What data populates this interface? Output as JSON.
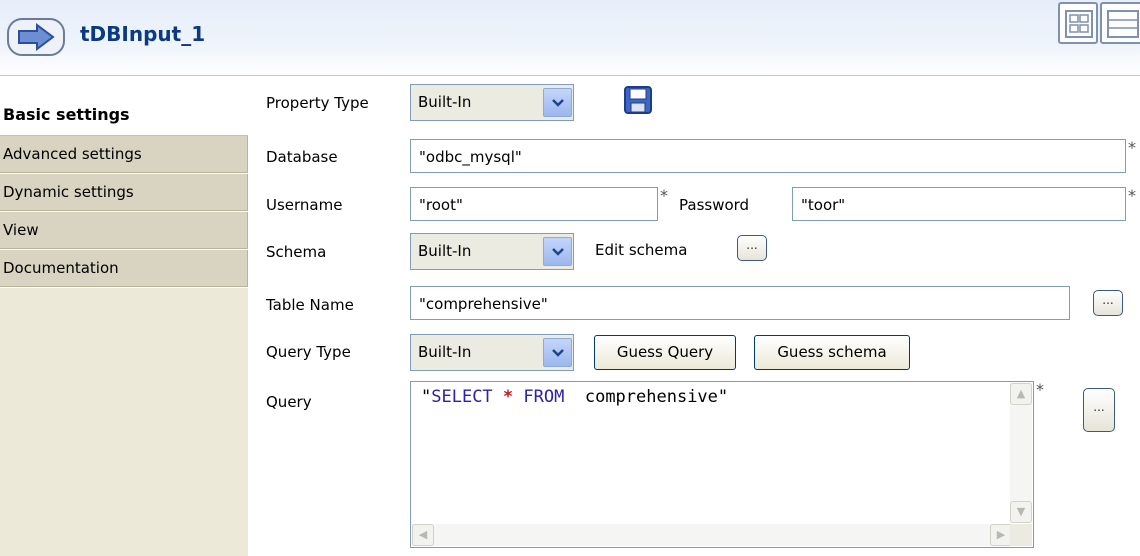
{
  "header": {
    "title": "tDBInput_1",
    "icon": "arrow-right-icon"
  },
  "tabs": [
    {
      "label": "Basic settings"
    },
    {
      "label": "Advanced settings"
    },
    {
      "label": "Dynamic settings"
    },
    {
      "label": "View"
    },
    {
      "label": "Documentation"
    }
  ],
  "form": {
    "property_type_label": "Property Type",
    "property_type_value": "Built-In",
    "database_label": "Database",
    "database_value": "\"odbc_mysql\"",
    "username_label": "Username",
    "username_value": "\"root\"",
    "password_label": "Password",
    "password_value": "\"toor\"",
    "schema_label": "Schema",
    "schema_value": "Built-In",
    "edit_schema_label": "Edit schema",
    "table_name_label": "Table Name",
    "table_name_value": "\"comprehensive\"",
    "query_type_label": "Query Type",
    "query_type_value": "Built-In",
    "guess_query_label": "Guess Query",
    "guess_schema_label": "Guess schema",
    "query_label": "Query",
    "query_open": "\"",
    "query_select": "SELECT",
    "query_star": "*",
    "query_from": "FROM",
    "query_rest": "  comprehensive\"",
    "required_mark": "*",
    "dots": "..."
  },
  "colors": {
    "title": "#0a3a83",
    "keyword": "#2a22a8",
    "asterisk": "#c01d1d"
  }
}
